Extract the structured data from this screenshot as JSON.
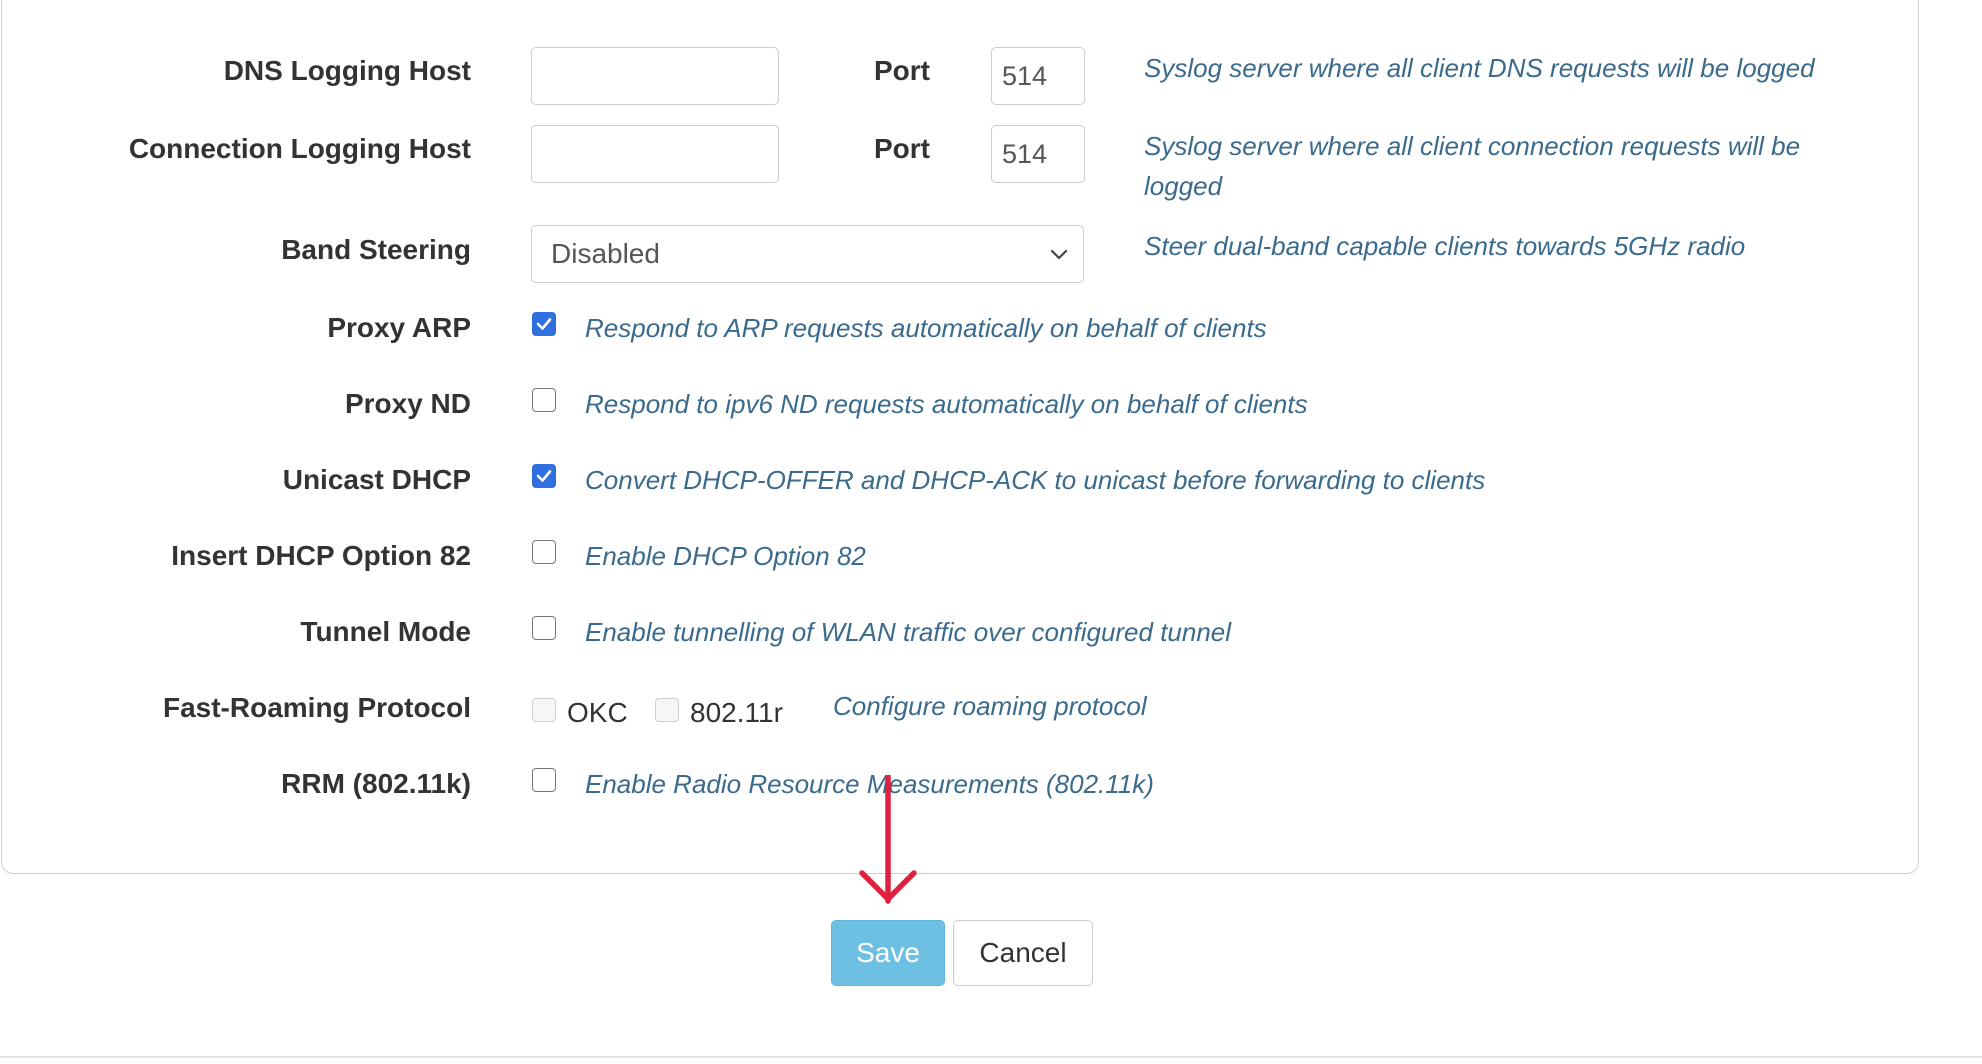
{
  "form": {
    "dns_logging": {
      "label": "DNS Logging Host",
      "host_value": "",
      "port_label": "Port",
      "port_value": "514",
      "help": "Syslog server where all client DNS requests will be logged"
    },
    "connection_logging": {
      "label": "Connection Logging Host",
      "host_value": "",
      "port_label": "Port",
      "port_value": "514",
      "help_line1": "Syslog server where all client connection requests will be",
      "help_line2": "logged"
    },
    "band_steering": {
      "label": "Band Steering",
      "selected": "Disabled",
      "help": "Steer dual-band capable clients towards 5GHz radio"
    },
    "proxy_arp": {
      "label": "Proxy ARP",
      "checked": true,
      "help": "Respond to ARP requests automatically on behalf of clients"
    },
    "proxy_nd": {
      "label": "Proxy ND",
      "checked": false,
      "help": "Respond to ipv6 ND requests automatically on behalf of clients"
    },
    "unicast_dhcp": {
      "label": "Unicast DHCP",
      "checked": true,
      "help": "Convert DHCP-OFFER and DHCP-ACK to unicast before forwarding to clients"
    },
    "dhcp_option_82": {
      "label": "Insert DHCP Option 82",
      "checked": false,
      "help": "Enable DHCP Option 82"
    },
    "tunnel_mode": {
      "label": "Tunnel Mode",
      "checked": false,
      "help": "Enable tunnelling of WLAN traffic over configured tunnel"
    },
    "fast_roaming": {
      "label": "Fast-Roaming Protocol",
      "okc_label": "OKC",
      "okc_checked": false,
      "r_label": "802.11r",
      "r_checked": false,
      "help": "Configure roaming protocol"
    },
    "rrm": {
      "label": "RRM (802.11k)",
      "checked": false,
      "help": "Enable Radio Resource Measurements (802.11k)"
    }
  },
  "buttons": {
    "save_label": "Save",
    "cancel_label": "Cancel"
  },
  "colors": {
    "accent_checkbox": "#2f6fe0",
    "save_button": "#6ec0e2",
    "help_text": "#3a6a8c",
    "annotation_arrow": "#e0203f"
  },
  "icons": {
    "select_chevron": "chevron-down-icon",
    "annotation": "arrow-down-icon"
  }
}
